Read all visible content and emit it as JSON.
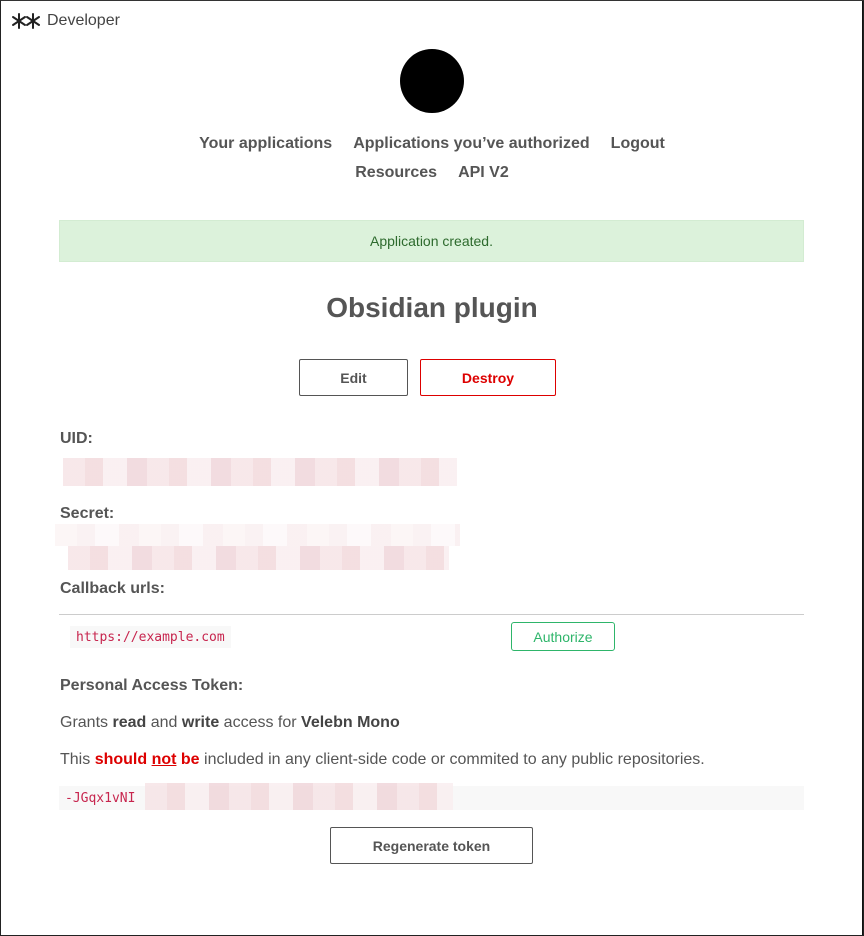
{
  "header": {
    "brand": "Developer",
    "brand_icon": "asterisk-pair-icon"
  },
  "nav": {
    "row1": [
      "Your applications",
      "Applications you’ve authorized",
      "Logout"
    ],
    "row2": [
      "Resources",
      "API V2"
    ]
  },
  "flash": {
    "message": "Application created."
  },
  "app": {
    "title": "Obsidian plugin"
  },
  "actions": {
    "edit": "Edit",
    "destroy": "Destroy"
  },
  "fields": {
    "uid_label": "UID:",
    "secret_label": "Secret:",
    "callback_label": "Callback urls:",
    "callback_url": "https://example.com",
    "authorize": "Authorize"
  },
  "token": {
    "label": "Personal Access Token:",
    "grants_prefix": "Grants",
    "grants_read": "read",
    "grants_and": "and",
    "grants_write": "write",
    "grants_for": "access for",
    "grants_account": "Velebn Mono",
    "warning_prefix": "This",
    "warning_should": "should",
    "warning_not": "not",
    "warning_be": "be",
    "warning_rest": "included in any client-side code or commited to any public repositories.",
    "value_visible": "-JGqx1vNI",
    "regenerate": "Regenerate token"
  },
  "colors": {
    "accent_red": "#dd0000",
    "accent_green": "#2eb56a",
    "flash_bg": "#dcf2db"
  }
}
